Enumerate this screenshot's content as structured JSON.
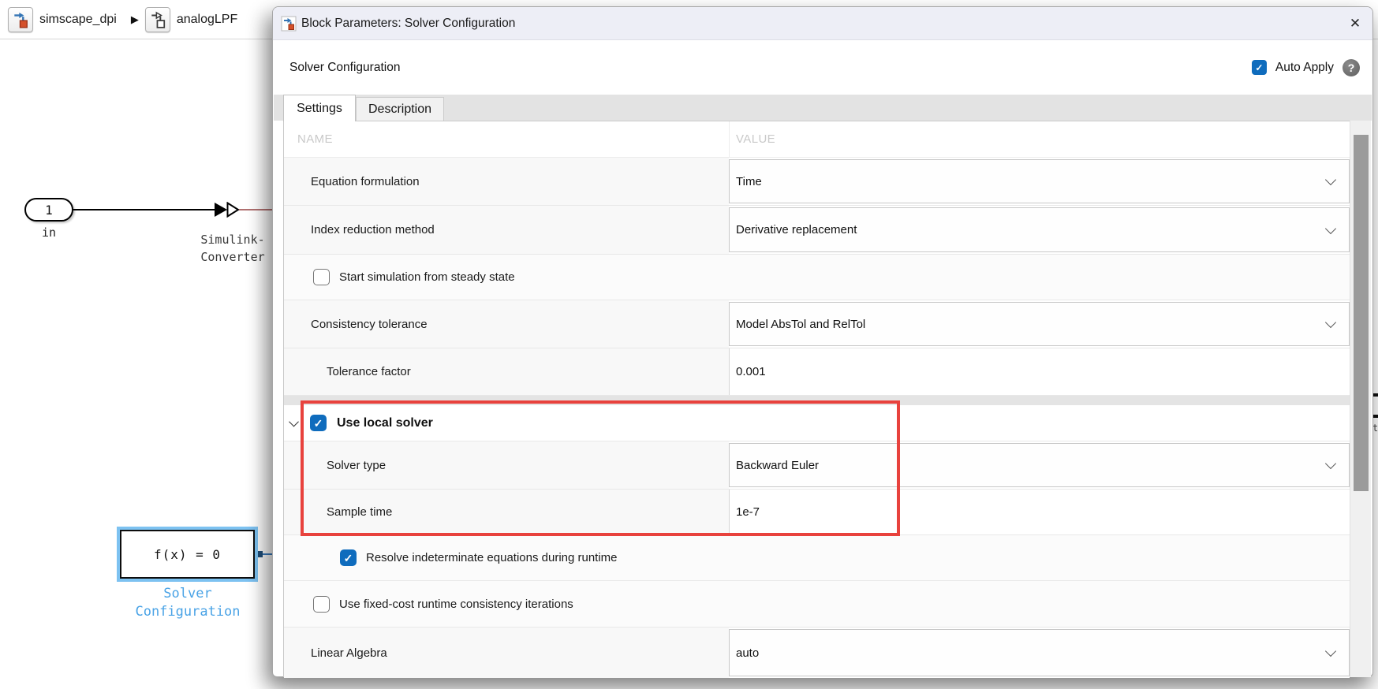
{
  "canvas": {
    "breadcrumb": [
      {
        "label": "simscape_dpi",
        "icon": "simulink-model-icon"
      },
      {
        "label": "analogLPF",
        "icon": "subsystem-icon"
      }
    ],
    "breadcrumb_separator": "▶",
    "inport": {
      "number": "1",
      "label": "in"
    },
    "converter": {
      "line1": "Simulink-",
      "line2": "Converter"
    },
    "solver_block": {
      "text": "f(x) = 0",
      "label1": "Solver",
      "label2": "Configuration"
    },
    "edge_fragment": "t"
  },
  "dialog": {
    "title": "Block Parameters: Solver Configuration",
    "subtitle": "Solver Configuration",
    "auto_apply": {
      "label": "Auto Apply",
      "checked": true
    },
    "tabs": [
      {
        "label": "Settings",
        "active": true
      },
      {
        "label": "Description",
        "active": false
      }
    ],
    "columns": {
      "name": "NAME",
      "value": "VALUE"
    },
    "rows": [
      {
        "type": "dropdown",
        "name": "Equation formulation",
        "value": "Time"
      },
      {
        "type": "dropdown",
        "name": "Index reduction method",
        "value": "Derivative replacement"
      },
      {
        "type": "checkbox",
        "name": "Start simulation from steady state",
        "checked": false
      },
      {
        "type": "dropdown",
        "name": "Consistency tolerance",
        "value": "Model AbsTol and RelTol"
      },
      {
        "type": "edit",
        "name": "Tolerance factor",
        "value": "0.001"
      },
      {
        "type": "section",
        "name": "Use local solver",
        "checked": true,
        "expanded": true
      },
      {
        "type": "dropdown",
        "name": "Solver type",
        "value": "Backward Euler"
      },
      {
        "type": "edit",
        "name": "Sample time",
        "value": "1e-7"
      },
      {
        "type": "checkbox",
        "name": "Resolve indeterminate equations during runtime",
        "checked": true
      },
      {
        "type": "checkbox",
        "name": "Use fixed-cost runtime consistency iterations",
        "checked": false
      },
      {
        "type": "dropdown",
        "name": "Linear Algebra",
        "value": "auto"
      }
    ]
  },
  "icons": {
    "check": "✓",
    "close": "✕",
    "help": "?"
  },
  "colors": {
    "checkbox_blue": "#0f6cbd",
    "annotation_red": "#e8423d",
    "selection_blue": "#7dc2f1",
    "block_label_blue": "#4aa3e6",
    "physical_wire_red": "#b07070",
    "signal_wire_blue": "#3a7cc0",
    "titlebar_bg": "#edeef6"
  }
}
